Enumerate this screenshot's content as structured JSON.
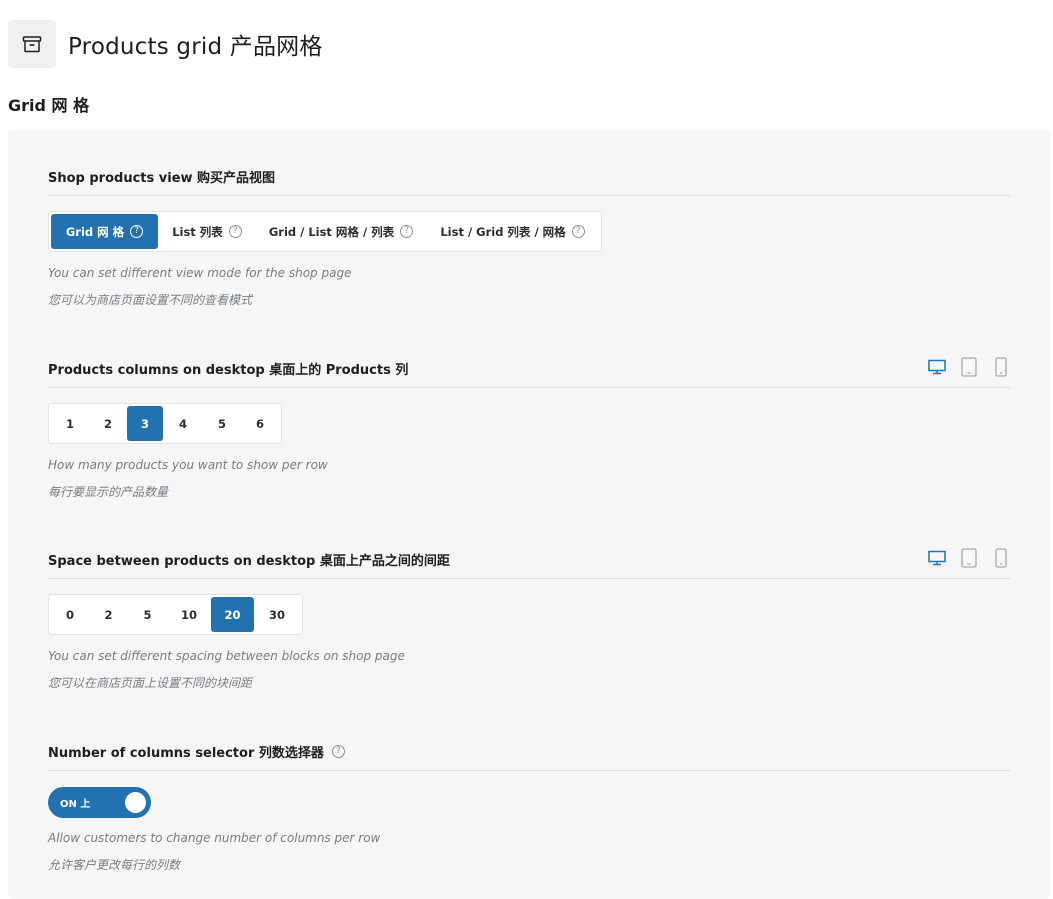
{
  "header": {
    "icon": "archive-box-icon",
    "title": "Products grid  产品网格"
  },
  "section": {
    "title": "Grid  网 格"
  },
  "fields": {
    "view": {
      "label": "Shop products view  购买产品视图",
      "options": [
        "Grid  网 格",
        "List  列表",
        "Grid / List  网格 / 列表",
        "List / Grid  列表 / 网格"
      ],
      "selected": "Grid  网 格",
      "help_icon": "question-circle-icon",
      "desc_en": "You can set different view mode for the shop page",
      "desc_zh": "您可以为商店页面设置不同的查看模式"
    },
    "columns": {
      "label": "Products columns on desktop  桌面上的 Products 列",
      "options": [
        "1",
        "2",
        "3",
        "4",
        "5",
        "6"
      ],
      "selected": "3",
      "devices": [
        "desktop-icon",
        "tablet-icon",
        "mobile-icon"
      ],
      "active_device": "desktop-icon",
      "desc_en": "How many products you want to show per row",
      "desc_zh": "每行要显示的产品数量"
    },
    "spacing": {
      "label": "Space between products on desktop  桌面上产品之间的间距",
      "options": [
        "0",
        "2",
        "5",
        "10",
        "20",
        "30"
      ],
      "selected": "20",
      "devices": [
        "desktop-icon",
        "tablet-icon",
        "mobile-icon"
      ],
      "active_device": "desktop-icon",
      "desc_en": "You can set different spacing between blocks on shop page",
      "desc_zh": "您可以在商店页面上设置不同的块间距"
    },
    "selector": {
      "label": "Number of columns selector  列数选择器",
      "help_icon": "question-circle-icon",
      "toggle_label": "ON  上",
      "toggle_on": true,
      "desc_en": "Allow customers to change number of columns per row",
      "desc_zh": "允许客户更改每行的列数"
    }
  },
  "colors": {
    "accent": "#2271b1",
    "panel_bg": "#f6f6f6",
    "muted_text": "#787c82"
  }
}
